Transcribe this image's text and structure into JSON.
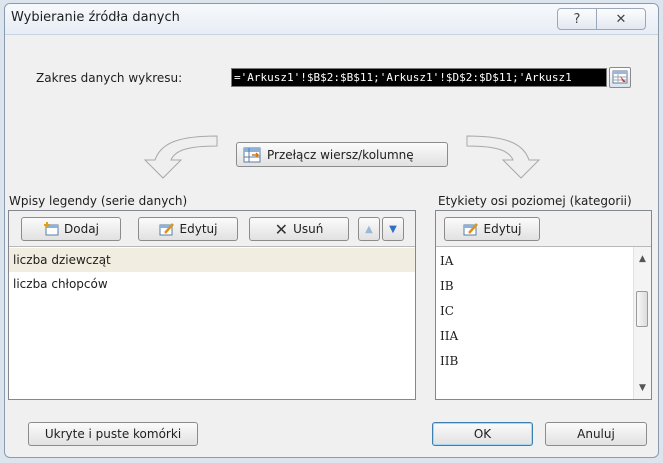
{
  "title": "Wybieranie źródła danych",
  "title_buttons": {
    "help": "?",
    "close": "✕"
  },
  "range": {
    "label": "Zakres danych wykresu:",
    "value": "='Arkusz1'!$B$2:$B$11;'Arkusz1'!$D$2:$D$11;'Arkusz1"
  },
  "switch_button": "Przełącz wiersz/kolumnę",
  "legend": {
    "label": "Wpisy legendy (serie danych)",
    "buttons": {
      "add": "Dodaj",
      "edit": "Edytuj",
      "remove": "Usuń"
    },
    "series": [
      "liczba dziewcząt",
      "liczba chłopców"
    ]
  },
  "axis": {
    "label": "Etykiety osi poziomej (kategorii)",
    "edit": "Edytuj",
    "categories": [
      "IA",
      "IB",
      "IC",
      "IIA",
      "IIB"
    ]
  },
  "footer": {
    "hidden_cells": "Ukryte i puste komórki",
    "ok": "OK",
    "cancel": "Anuluj"
  },
  "colors": {
    "selection": "#f1ede1",
    "arrow_blue": "#2f6fc4",
    "dialog_bg": "#f0f0f0"
  },
  "icons": [
    "help-icon",
    "close-icon",
    "range-picker-icon",
    "curved-arrow-icon",
    "switch-table-icon",
    "add-icon",
    "edit-icon",
    "remove-icon",
    "move-up-icon",
    "move-down-icon"
  ]
}
